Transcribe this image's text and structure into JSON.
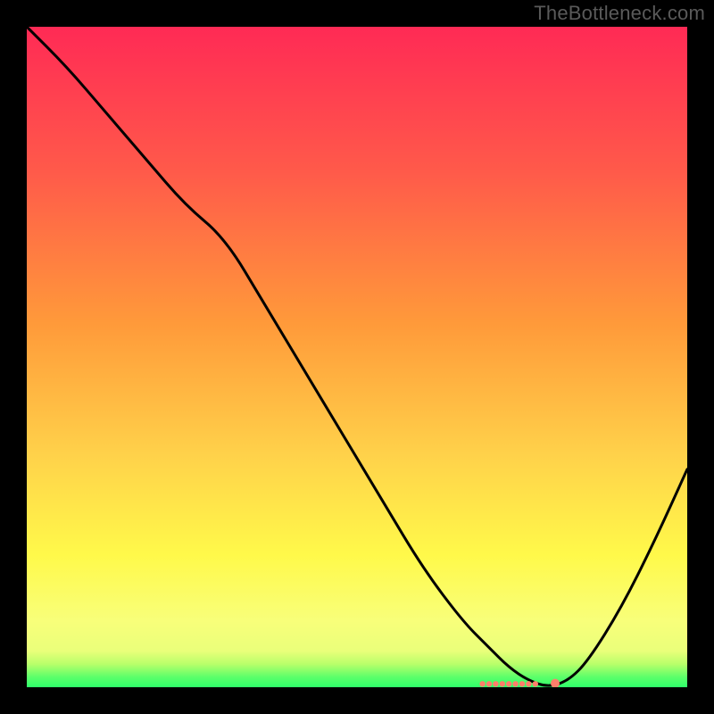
{
  "watermark": "TheBottleneck.com",
  "colors": {
    "background": "#000000",
    "curve": "#000000",
    "markers": "#ff7f6a",
    "gradient_top": "#ff2a55",
    "gradient_mid1": "#ff8a3a",
    "gradient_mid2": "#ffd24a",
    "gradient_mid3": "#fff94a",
    "gradient_bottom_yellow": "#f8ff7a",
    "gradient_green_edge": "#2eff6a"
  },
  "chart_data": {
    "type": "line",
    "title": "",
    "xlabel": "",
    "ylabel": "",
    "xlim": [
      0,
      100
    ],
    "ylim": [
      0,
      100
    ],
    "series": [
      {
        "name": "curve",
        "x": [
          0,
          6,
          12,
          18,
          24,
          30,
          36,
          42,
          48,
          54,
          60,
          66,
          70,
          73,
          76,
          79,
          82,
          85,
          90,
          95,
          100
        ],
        "y": [
          100,
          94,
          87,
          80,
          73,
          68,
          58,
          48,
          38,
          28,
          18,
          10,
          6,
          3,
          1,
          0,
          1,
          4,
          12,
          22,
          33
        ]
      }
    ],
    "markers": {
      "name": "bottom-cluster",
      "x": [
        69,
        70,
        71,
        72,
        73,
        74,
        75,
        76,
        77,
        80
      ],
      "y": [
        0.5,
        0.5,
        0.5,
        0.5,
        0.5,
        0.5,
        0.5,
        0.5,
        0.5,
        0.6
      ]
    },
    "gradient_stops": [
      {
        "pos": 0.0,
        "color": "#ff2a55"
      },
      {
        "pos": 0.22,
        "color": "#ff5a4a"
      },
      {
        "pos": 0.45,
        "color": "#ff9a3a"
      },
      {
        "pos": 0.65,
        "color": "#ffd24a"
      },
      {
        "pos": 0.8,
        "color": "#fff94a"
      },
      {
        "pos": 0.9,
        "color": "#f8ff7a"
      },
      {
        "pos": 0.945,
        "color": "#eaff7a"
      },
      {
        "pos": 0.965,
        "color": "#b8ff6a"
      },
      {
        "pos": 0.985,
        "color": "#5aff6a"
      },
      {
        "pos": 1.0,
        "color": "#2eff6a"
      }
    ]
  }
}
